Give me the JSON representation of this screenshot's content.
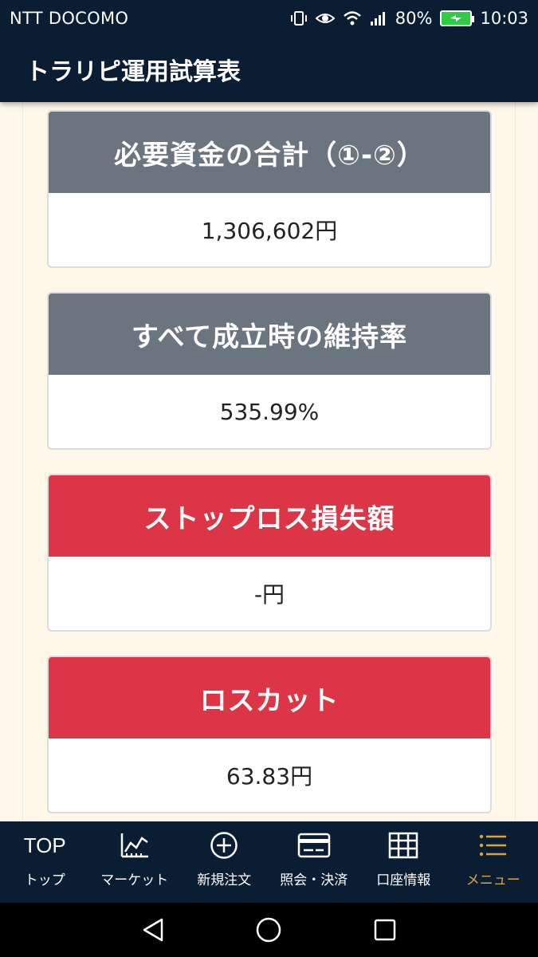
{
  "status_bar": {
    "carrier": "NTT DOCOMO",
    "battery_percent": "80%",
    "time": "10:03"
  },
  "header": {
    "title": "トラリピ運用試算表"
  },
  "cards": [
    {
      "title": "必要資金の合計（①-②）",
      "value": "1,306,602円",
      "style": "gray"
    },
    {
      "title": "すべて成立時の維持率",
      "value": "535.99%",
      "style": "gray"
    },
    {
      "title": "ストップロス損失額",
      "value": "-円",
      "style": "red"
    },
    {
      "title": "ロスカット",
      "value": "63.83円",
      "style": "red"
    }
  ],
  "bottom_nav": [
    {
      "top_text": "TOP",
      "label": "トップ",
      "icon": "top-text"
    },
    {
      "label": "マーケット",
      "icon": "chart-icon"
    },
    {
      "label": "新規注文",
      "icon": "plus-circle-icon"
    },
    {
      "label": "照会・決済",
      "icon": "card-icon"
    },
    {
      "label": "口座情報",
      "icon": "grid-icon"
    },
    {
      "label": "メニュー",
      "icon": "menu-icon",
      "active": true
    }
  ],
  "colors": {
    "header_bg": "#0b1d33",
    "gray_head": "#6b7580",
    "red_head": "#dc3545",
    "active_nav": "#d9a441"
  }
}
